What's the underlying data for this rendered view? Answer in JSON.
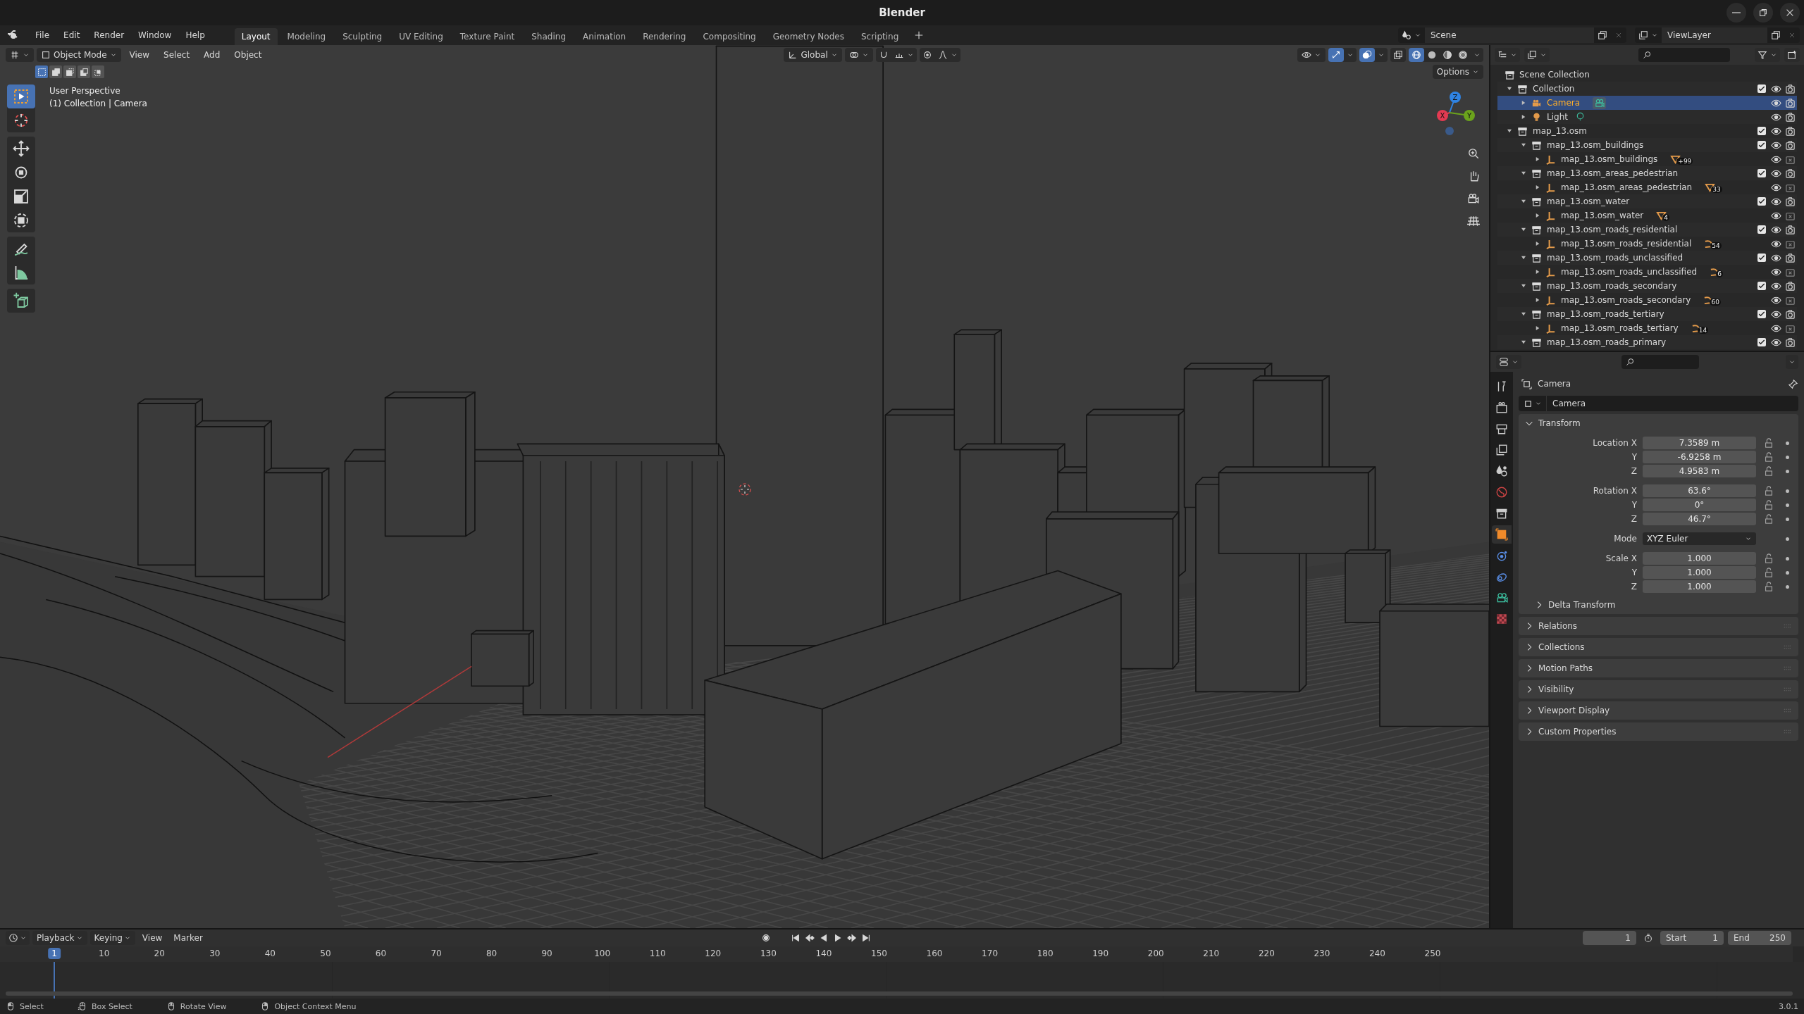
{
  "window": {
    "title": "Blender"
  },
  "menus": [
    "File",
    "Edit",
    "Render",
    "Window",
    "Help"
  ],
  "workspaces": [
    {
      "label": "Layout",
      "selected": true
    },
    {
      "label": "Modeling",
      "selected": false
    },
    {
      "label": "Sculpting",
      "selected": false
    },
    {
      "label": "UV Editing",
      "selected": false
    },
    {
      "label": "Texture Paint",
      "selected": false
    },
    {
      "label": "Shading",
      "selected": false
    },
    {
      "label": "Animation",
      "selected": false
    },
    {
      "label": "Rendering",
      "selected": false
    },
    {
      "label": "Compositing",
      "selected": false
    },
    {
      "label": "Geometry Nodes",
      "selected": false
    },
    {
      "label": "Scripting",
      "selected": false
    }
  ],
  "scene": {
    "scene": "Scene",
    "view_layer": "ViewLayer"
  },
  "viewport": {
    "mode": "Object Mode",
    "menus": [
      "View",
      "Select",
      "Add",
      "Object"
    ],
    "orientation": "Global",
    "options": "Options",
    "select_modes": [
      {
        "kind": "set",
        "selected": true
      },
      {
        "kind": "extend",
        "selected": false
      },
      {
        "kind": "subtract",
        "selected": false
      },
      {
        "kind": "invert",
        "selected": false
      },
      {
        "kind": "intersect",
        "selected": false
      }
    ],
    "toggles": [
      {
        "kind": "gizmos",
        "on": true
      },
      {
        "kind": "overlays",
        "on": true
      },
      {
        "kind": "xray",
        "on": false
      }
    ],
    "shading": [
      {
        "kind": "wireframe",
        "selected": true
      },
      {
        "kind": "solid",
        "selected": false
      },
      {
        "kind": "material",
        "selected": false
      },
      {
        "kind": "rendered",
        "selected": false
      }
    ],
    "info": [
      "User Perspective",
      "(1) Collection | Camera"
    ],
    "tools": [
      {
        "kind": "select",
        "selected": true
      },
      {
        "kind": "cursor",
        "selected": false
      },
      {
        "kind": "move",
        "selected": false
      },
      {
        "kind": "rotate",
        "selected": false
      },
      {
        "kind": "scale",
        "selected": false
      },
      {
        "kind": "transform",
        "selected": false
      },
      {
        "kind": "annotate",
        "selected": false
      },
      {
        "kind": "measure",
        "selected": false
      },
      {
        "kind": "add-cube",
        "selected": false
      }
    ],
    "axes": [
      {
        "label": "Z",
        "color": "#2f83e3"
      },
      {
        "label": "Y",
        "color": "#6ba31c"
      },
      {
        "label": "X",
        "color": "#e33a52"
      }
    ]
  },
  "outliner": {
    "root": "Scene Collection",
    "items": [
      {
        "label": "Collection",
        "kind": "collection",
        "expanded": true,
        "selected": false,
        "checked": true,
        "renderable": true,
        "children": [
          {
            "label": "Camera",
            "kind": "camera",
            "expanded": false,
            "selected": true,
            "renderable": true,
            "data": {
              "kind": "camera"
            }
          },
          {
            "label": "Light",
            "kind": "light",
            "expanded": false,
            "selected": false,
            "renderable": true,
            "data": {
              "kind": "light"
            }
          }
        ]
      },
      {
        "label": "map_13.osm",
        "kind": "collection",
        "expanded": true,
        "selected": false,
        "checked": true,
        "renderable": true,
        "children": [
          {
            "label": "map_13.osm_buildings",
            "kind": "collection",
            "expanded": true,
            "selected": false,
            "checked": true,
            "renderable": true,
            "children": [
              {
                "label": "map_13.osm_buildings",
                "kind": "object",
                "expanded": false,
                "selected": false,
                "renderable": false,
                "data": {
                  "kind": "mesh",
                  "count": "+99"
                }
              }
            ]
          },
          {
            "label": "map_13.osm_areas_pedestrian",
            "kind": "collection",
            "expanded": true,
            "selected": false,
            "checked": true,
            "renderable": true,
            "children": [
              {
                "label": "map_13.osm_areas_pedestrian",
                "kind": "object",
                "expanded": false,
                "selected": false,
                "renderable": false,
                "data": {
                  "kind": "mesh",
                  "count": "33"
                }
              }
            ]
          },
          {
            "label": "map_13.osm_water",
            "kind": "collection",
            "expanded": true,
            "selected": false,
            "checked": true,
            "renderable": true,
            "children": [
              {
                "label": "map_13.osm_water",
                "kind": "object",
                "expanded": false,
                "selected": false,
                "renderable": false,
                "data": {
                  "kind": "mesh",
                  "count": "4"
                }
              }
            ]
          },
          {
            "label": "map_13.osm_roads_residential",
            "kind": "collection",
            "expanded": true,
            "selected": false,
            "checked": true,
            "renderable": true,
            "children": [
              {
                "label": "map_13.osm_roads_residential",
                "kind": "object",
                "expanded": false,
                "selected": false,
                "renderable": false,
                "data": {
                  "kind": "curve",
                  "count": "54"
                }
              }
            ]
          },
          {
            "label": "map_13.osm_roads_unclassified",
            "kind": "collection",
            "expanded": true,
            "selected": false,
            "checked": true,
            "renderable": true,
            "children": [
              {
                "label": "map_13.osm_roads_unclassified",
                "kind": "object",
                "expanded": false,
                "selected": false,
                "renderable": false,
                "data": {
                  "kind": "curve",
                  "count": "6"
                }
              }
            ]
          },
          {
            "label": "map_13.osm_roads_secondary",
            "kind": "collection",
            "expanded": true,
            "selected": false,
            "checked": true,
            "renderable": true,
            "children": [
              {
                "label": "map_13.osm_roads_secondary",
                "kind": "object",
                "expanded": false,
                "selected": false,
                "renderable": false,
                "data": {
                  "kind": "curve",
                  "count": "60"
                }
              }
            ]
          },
          {
            "label": "map_13.osm_roads_tertiary",
            "kind": "collection",
            "expanded": true,
            "selected": false,
            "checked": true,
            "renderable": true,
            "children": [
              {
                "label": "map_13.osm_roads_tertiary",
                "kind": "object",
                "expanded": false,
                "selected": false,
                "renderable": false,
                "data": {
                  "kind": "curve",
                  "count": "14"
                }
              }
            ]
          },
          {
            "label": "map_13.osm_roads_primary",
            "kind": "collection",
            "expanded": true,
            "selected": false,
            "checked": true,
            "renderable": true
          }
        ]
      }
    ]
  },
  "properties": {
    "tabs": [
      {
        "kind": "tool",
        "selected": false
      },
      {
        "kind": "render",
        "selected": false
      },
      {
        "kind": "output",
        "selected": false
      },
      {
        "kind": "view-layer",
        "selected": false
      },
      {
        "kind": "scene",
        "selected": false
      },
      {
        "kind": "world",
        "selected": false
      },
      {
        "kind": "collection",
        "selected": false
      },
      {
        "kind": "object",
        "selected": true
      },
      {
        "kind": "physics",
        "selected": false
      },
      {
        "kind": "constraints",
        "selected": false
      },
      {
        "kind": "camera-data",
        "selected": false
      },
      {
        "kind": "texture",
        "selected": false
      }
    ],
    "context": "Camera",
    "name": "Camera",
    "transform": {
      "title": "Transform",
      "expanded": true,
      "groups": [
        {
          "rows": [
            {
              "label": "Location X",
              "value": "7.3589 m",
              "kind": "number"
            },
            {
              "label": "Y",
              "value": "-6.9258 m",
              "kind": "number"
            },
            {
              "label": "Z",
              "value": "4.9583 m",
              "kind": "number"
            }
          ]
        },
        {
          "rows": [
            {
              "label": "Rotation X",
              "value": "63.6°",
              "kind": "number"
            },
            {
              "label": "Y",
              "value": "0°",
              "kind": "number"
            },
            {
              "label": "Z",
              "value": "46.7°",
              "kind": "number"
            }
          ]
        },
        {
          "rows": [
            {
              "label": "Mode",
              "value": "XYZ Euler",
              "kind": "dropdown"
            }
          ]
        },
        {
          "rows": [
            {
              "label": "Scale X",
              "value": "1.000",
              "kind": "number"
            },
            {
              "label": "Y",
              "value": "1.000",
              "kind": "number"
            },
            {
              "label": "Z",
              "value": "1.000",
              "kind": "number"
            }
          ]
        }
      ],
      "subpanels": [
        {
          "title": "Delta Transform",
          "expanded": false
        }
      ]
    },
    "panels": [
      {
        "title": "Relations",
        "expanded": false
      },
      {
        "title": "Collections",
        "expanded": false
      },
      {
        "title": "Motion Paths",
        "expanded": false
      },
      {
        "title": "Visibility",
        "expanded": false
      },
      {
        "title": "Viewport Display",
        "expanded": false
      },
      {
        "title": "Custom Properties",
        "expanded": false
      }
    ]
  },
  "timeline": {
    "menus": [
      "Playback",
      "Keying",
      "View",
      "Marker"
    ],
    "current_frame": "1",
    "start": {
      "label": "Start",
      "value": "1"
    },
    "end": {
      "label": "End",
      "value": "250"
    },
    "playhead": "1",
    "ruler": [
      "10",
      "20",
      "30",
      "40",
      "50",
      "60",
      "70",
      "80",
      "90",
      "100",
      "110",
      "120",
      "130",
      "140",
      "150",
      "160",
      "170",
      "180",
      "190",
      "200",
      "210",
      "220",
      "230",
      "240",
      "250"
    ]
  },
  "status_bar": {
    "hints": [
      {
        "kind": "mouse-left",
        "label": "Select"
      },
      {
        "kind": "mouse-drag",
        "label": "Box Select"
      },
      {
        "kind": "mouse-middle",
        "label": "Rotate View"
      },
      {
        "kind": "mouse-right",
        "label": "Object Context Menu"
      }
    ],
    "version": "3.0.1"
  }
}
